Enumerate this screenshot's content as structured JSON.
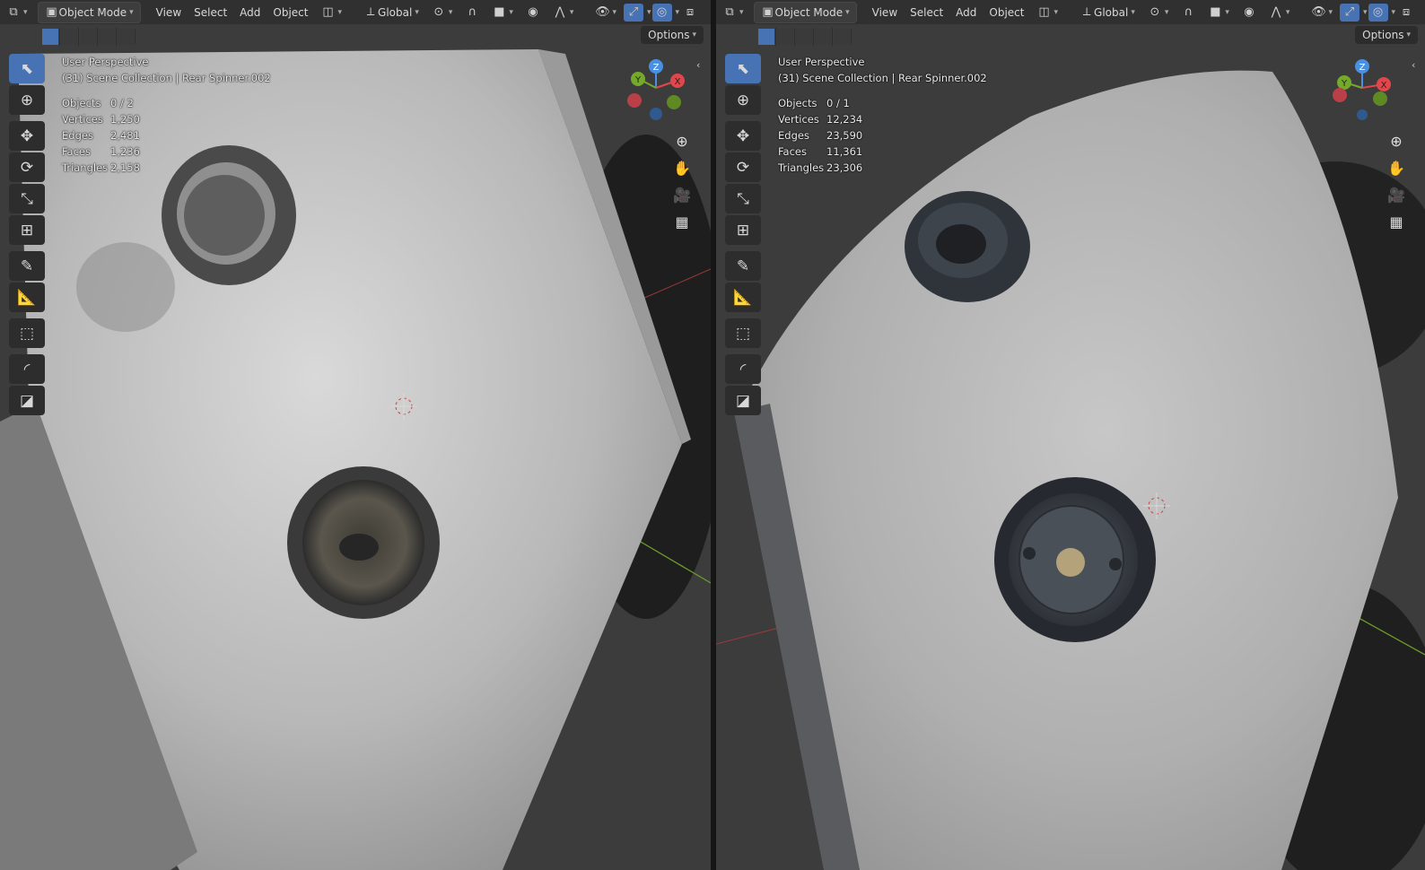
{
  "header": {
    "mode": "Object Mode",
    "menus": [
      "View",
      "Select",
      "Add",
      "Object"
    ],
    "transform_orientation": "Global"
  },
  "subbar": {
    "options_label": "Options"
  },
  "colors": {
    "accent": "#4772b3",
    "axis_x": "#e0474c",
    "axis_y": "#74a92b",
    "axis_z": "#4a90e2"
  },
  "viewports": [
    {
      "name": "left",
      "perspective": "User Perspective",
      "collection": "(31) Scene Collection | Rear Spinner.002",
      "stats": [
        {
          "label": "Objects",
          "value": "0 / 2"
        },
        {
          "label": "Vertices",
          "value": "1,250"
        },
        {
          "label": "Edges",
          "value": "2,481"
        },
        {
          "label": "Faces",
          "value": "1,236"
        },
        {
          "label": "Triangles",
          "value": "2,158"
        }
      ]
    },
    {
      "name": "right",
      "perspective": "User Perspective",
      "collection": "(31) Scene Collection | Rear Spinner.002",
      "stats": [
        {
          "label": "Objects",
          "value": "0 / 1"
        },
        {
          "label": "Vertices",
          "value": "12,234"
        },
        {
          "label": "Edges",
          "value": "23,590"
        },
        {
          "label": "Faces",
          "value": "11,361"
        },
        {
          "label": "Triangles",
          "value": "23,306"
        }
      ]
    }
  ],
  "gizmo": {
    "x": "X",
    "y": "Y",
    "z": "Z"
  },
  "tools": [
    "select-box",
    "cursor",
    "move",
    "rotate",
    "scale",
    "transform",
    "annotate",
    "measure",
    "add-cube",
    "bevel",
    "inset"
  ]
}
